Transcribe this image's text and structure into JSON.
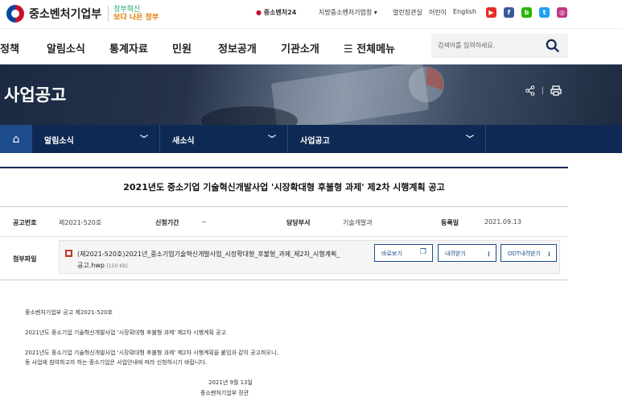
{
  "header": {
    "logo_text": "중소벤처기업부",
    "slogan_line1": "정부혁신",
    "slogan_line2": "보다 나은 정부",
    "utility": [
      "중소벤처24",
      "지방중소벤처기업청",
      "열린장관실",
      "어린이",
      "English"
    ],
    "social": [
      {
        "name": "youtube",
        "glyph": "▶",
        "color": "#e52d27"
      },
      {
        "name": "facebook",
        "glyph": "f",
        "color": "#3b5998"
      },
      {
        "name": "blog",
        "glyph": "b",
        "color": "#2db400"
      },
      {
        "name": "twitter",
        "glyph": "t",
        "color": "#1da1f2"
      },
      {
        "name": "instagram",
        "glyph": "◎",
        "color": "#c13584"
      }
    ]
  },
  "gnb": {
    "items": [
      "정책",
      "알림소식",
      "통계자료",
      "민원",
      "정보공개",
      "기관소개"
    ],
    "all_menu": "☰ 전체메뉴",
    "search_placeholder": "검색어를 입력하세요."
  },
  "hero": {
    "title": "사업공고"
  },
  "breadcrumb": {
    "home_icon": "⌂",
    "levels": [
      "알림소식",
      "새소식",
      "사업공고"
    ]
  },
  "notice": {
    "title": "2021년도 중소기업 기술혁신개발사업 '시장확대형 후불형 과제' 제2차 시행계획 공고",
    "fields": {
      "no_label": "공고번호",
      "no_value": "제2021-520호",
      "period_label": "신청기간",
      "period_value": "~",
      "dept_label": "담당부서",
      "dept_value": "기술개발과",
      "date_label": "등록일",
      "date_value": "2021.09.13"
    },
    "attachment": {
      "label": "첨부파일",
      "file_icon": "hwp",
      "filename": "(제2021-520호)2021년_중소기업기술혁신개발사업_시장확대형_후불형_과제_제2차_시행계획_",
      "filename_end": "공고.hwp",
      "size": "[150 KB]",
      "buttons": [
        "바로보기",
        "내려받기",
        "ODT내려받기"
      ]
    },
    "body": {
      "line1": "중소벤처기업부 공고 제2021-520호",
      "line2": "2021년도 중소기업 기술혁신개발사업 '시장확대형 후불형 과제' 제2차 시행계획 공고",
      "line3": "2021년도 중소기업 기술혁신개발사업 '시장확대형 후불형 과제' 제2차 시행계획을 붙임과 같이 공고하오니,",
      "line4": "동 사업에 참여하고자 하는 중소기업은 사업안내에 따라 신청하시기 바랍니다.",
      "date": "2021년 9월 13일",
      "signer": "중소벤처기업부 장관"
    }
  }
}
